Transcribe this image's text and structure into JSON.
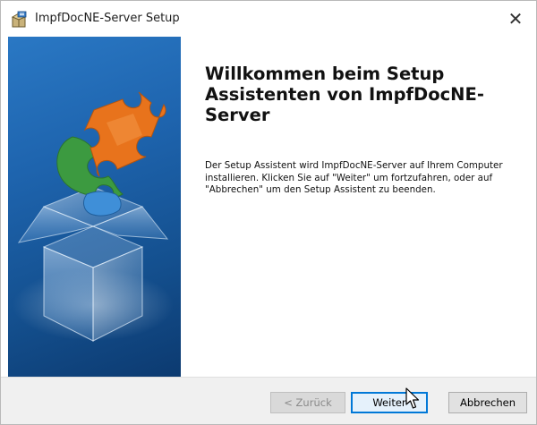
{
  "window": {
    "title": "ImpfDocNE-Server Setup",
    "close_glyph": "✕"
  },
  "content": {
    "heading": "Willkommen beim Setup Assistenten von ImpfDocNE-Server",
    "description": "Der Setup Assistent wird ImpfDocNE-Server auf Ihrem Computer installieren. Klicken Sie auf \"Weiter\" um fortzufahren, oder auf \"Abbrechen\" um den Setup Assistent zu beenden."
  },
  "buttons": {
    "back_label": "< Zurück",
    "next_label": "Weiter",
    "cancel_label": "Abbrechen"
  },
  "icons": {
    "app": "installer-package-icon",
    "banner": "puzzle-box-illustration",
    "cursor": "mouse-pointer-icon"
  },
  "colors": {
    "banner_blue": "#1e64ae",
    "focus_border": "#0078d7",
    "puzzle_orange": "#e8731c",
    "puzzle_green": "#3a9a3e"
  }
}
